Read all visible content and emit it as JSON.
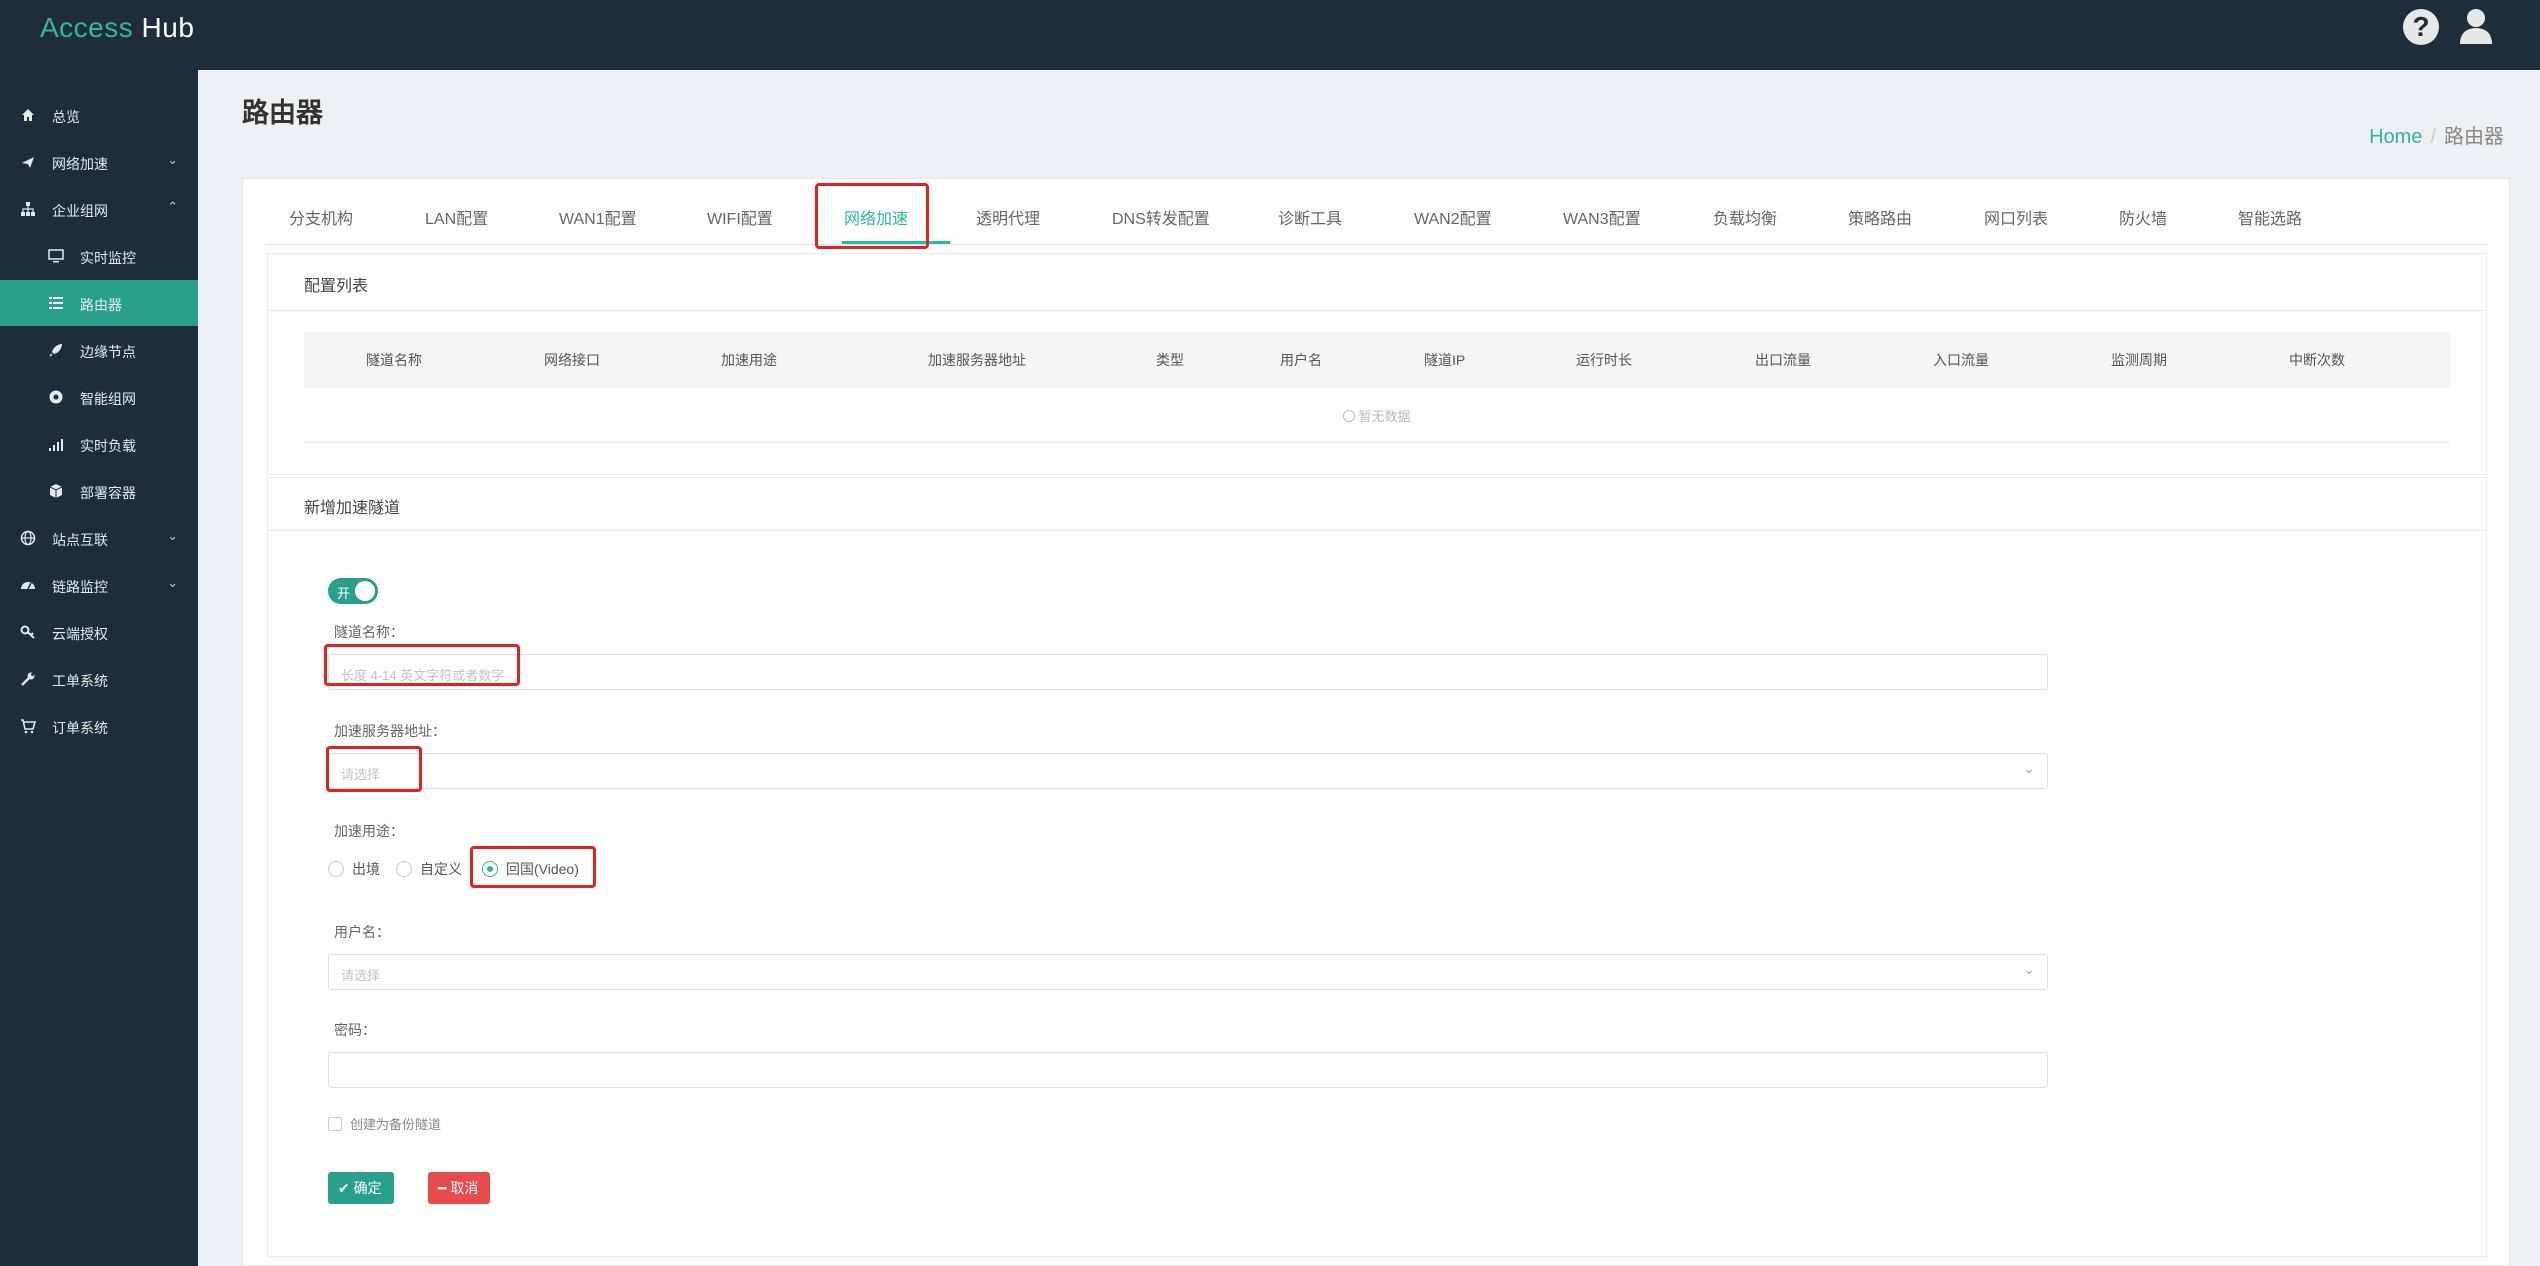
{
  "app": {
    "logo_prefix": "Access",
    "logo_suffix": "Hub"
  },
  "header_icons": {
    "help": "question-circle-icon",
    "user": "user-icon"
  },
  "sidebar": {
    "items": [
      {
        "label": "总览",
        "icon": "home-icon"
      },
      {
        "label": "网络加速",
        "icon": "plane-icon",
        "chevron": "⌄"
      },
      {
        "label": "企业组网",
        "icon": "sitemap-icon",
        "chevron": "⌃"
      },
      {
        "label": "实时监控",
        "icon": "monitor-icon"
      },
      {
        "label": "路由器",
        "icon": "list-icon"
      },
      {
        "label": "边缘节点",
        "icon": "rocket-icon"
      },
      {
        "label": "智能组网",
        "icon": "network-icon"
      },
      {
        "label": "实时负载",
        "icon": "signal-icon"
      },
      {
        "label": "部署容器",
        "icon": "cube-icon"
      },
      {
        "label": "站点互联",
        "icon": "globe-icon",
        "chevron": "⌄"
      },
      {
        "label": "链路监控",
        "icon": "dashboard-icon",
        "chevron": "⌄"
      },
      {
        "label": "云端授权",
        "icon": "key-icon"
      },
      {
        "label": "工单系统",
        "icon": "wrench-icon"
      },
      {
        "label": "订单系统",
        "icon": "cart-icon"
      }
    ],
    "active": "路由器"
  },
  "page": {
    "title": "路由器"
  },
  "breadcrumb": {
    "home": "Home",
    "sep": "/",
    "current": "路由器"
  },
  "tabs": [
    "分支机构",
    "LAN配置",
    "WAN1配置",
    "WIFI配置",
    "网络加速",
    "透明代理",
    "DNS转发配置",
    "诊断工具",
    "WAN2配置",
    "WAN3配置",
    "负载均衡",
    "策略路由",
    "网口列表",
    "防火墙",
    "智能选路"
  ],
  "active_tab": "网络加速",
  "config_list": {
    "title": "配置列表",
    "columns": [
      "隧道名称",
      "网络接口",
      "加速用途",
      "加速服务器地址",
      "类型",
      "用户名",
      "隧道IP",
      "运行时长",
      "出口流量",
      "入口流量",
      "监测周期",
      "中断次数"
    ],
    "empty_text": "暂无数据"
  },
  "form": {
    "title": "新增加速隧道",
    "toggle_label": "开",
    "tunnel_name_label": "隧道名称：",
    "tunnel_name_placeholder": "长度 4-14 英文字符或者数字",
    "server_label": "加速服务器地址：",
    "server_placeholder": "请选择",
    "purpose_label": "加速用途：",
    "purpose_options": [
      "出境",
      "自定义",
      "回国(Video)"
    ],
    "purpose_selected": "回国(Video)",
    "username_label": "用户名：",
    "username_placeholder": "请选择",
    "password_label": "密码：",
    "password_value": "",
    "backup_checkbox_label": "创建为备份隧道",
    "ok_label": "确定",
    "cancel_label": "取消"
  },
  "colors": {
    "accent": "#2fb7a0",
    "sidebar_bg": "#1f2d3a",
    "active_item": "#28a08c",
    "highlight": "#e02222",
    "danger": "#e74c4c"
  }
}
